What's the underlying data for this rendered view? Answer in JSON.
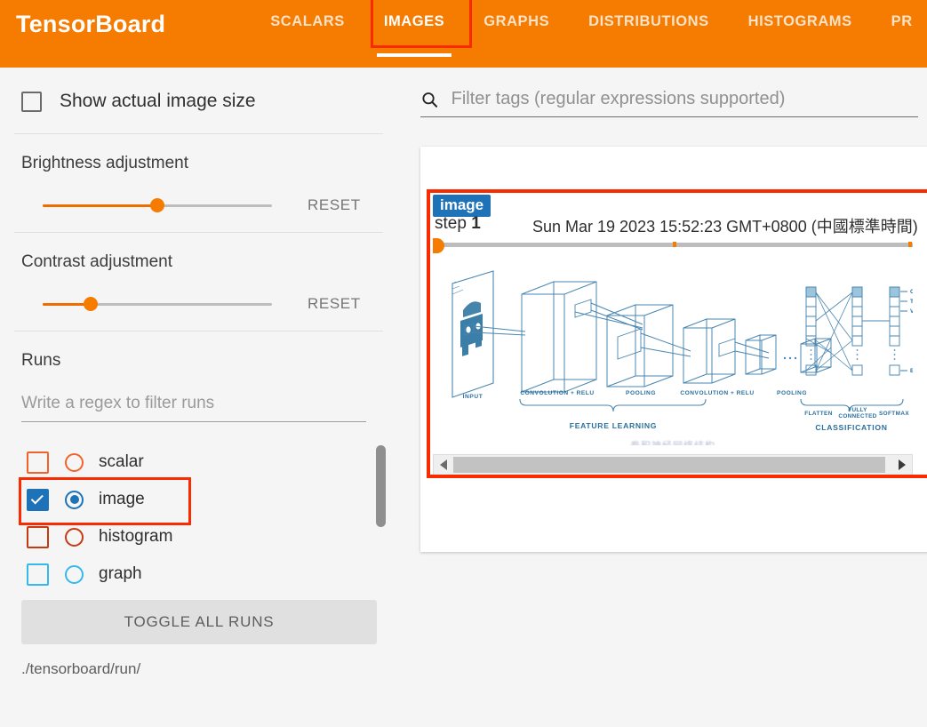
{
  "header": {
    "brand": "TensorBoard",
    "tabs": [
      {
        "label": "SCALARS",
        "active": false
      },
      {
        "label": "IMAGES",
        "active": true
      },
      {
        "label": "GRAPHS",
        "active": false
      },
      {
        "label": "DISTRIBUTIONS",
        "active": false
      },
      {
        "label": "HISTOGRAMS",
        "active": false
      },
      {
        "label": "PR",
        "active": false
      }
    ],
    "accent_color": "#f57c00",
    "annotation_color": "#f92b00"
  },
  "sidebar": {
    "actual_size": {
      "label": "Show actual image size",
      "checked": false
    },
    "brightness": {
      "title": "Brightness adjustment",
      "reset_label": "RESET",
      "value_percent": 50
    },
    "contrast": {
      "title": "Contrast adjustment",
      "reset_label": "RESET",
      "value_percent": 21
    },
    "runs": {
      "title": "Runs",
      "filter_placeholder": "Write a regex to filter runs",
      "filter_value": "",
      "items": [
        {
          "label": "scalar",
          "color": "#f4622b",
          "checked": false,
          "selected": false
        },
        {
          "label": "image",
          "color": "#1d72b8",
          "checked": true,
          "selected": true
        },
        {
          "label": "histogram",
          "color": "#c63a12",
          "checked": false,
          "selected": false
        },
        {
          "label": "graph",
          "color": "#35b8ec",
          "checked": false,
          "selected": false
        }
      ],
      "toggle_all_label": "TOGGLE ALL RUNS",
      "run_directory": "./tensorboard/run/"
    }
  },
  "main": {
    "filter": {
      "placeholder": "Filter tags (regular expressions supported)",
      "value": "",
      "icon": "search-icon"
    },
    "image_card": {
      "badge": "image",
      "step_prefix": "step",
      "step_value": "1",
      "timestamp": "Sun Mar 19 2023 15:52:23 GMT+0800 (中國標準時間)",
      "caption": "卷积神经网络结构",
      "figure": {
        "stage_labels": [
          "INPUT",
          "CONVOLUTION + RELU",
          "POOLING",
          "CONVOLUTION + RELU",
          "POOLING",
          "FLATTEN",
          "FULLY CONNECTED",
          "SOFTMAX"
        ],
        "group_labels": [
          "FEATURE LEARNING",
          "CLASSIFICATION"
        ],
        "class_labels": [
          "CAR",
          "TRUCK",
          "VAN",
          "BICYCLE"
        ],
        "line_color": "#4a86b0",
        "fill_color": "#3b7ea8"
      },
      "scrollbar": {
        "left_arrow": "◀",
        "right_arrow": "▶"
      }
    }
  }
}
